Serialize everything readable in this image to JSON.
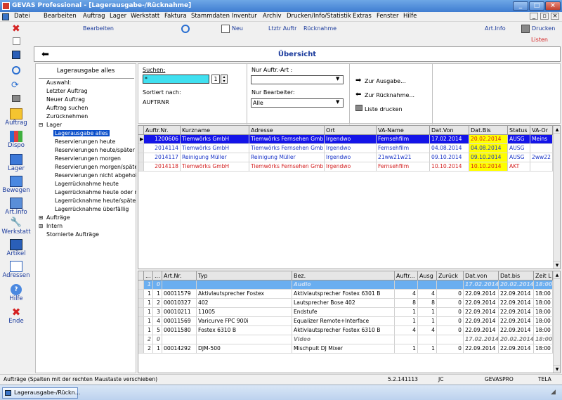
{
  "window": {
    "title": "GEVAS Professional - [Lagerausgabe-/Rücknahme]"
  },
  "menu": [
    "Datei",
    "Bearbeiten",
    "Auftrag",
    "Lager",
    "Werkstatt",
    "Faktura",
    "Stammdaten",
    "Inventur",
    "Archiv",
    "Drucken/Info/Statistik",
    "Extras",
    "Fenster",
    "Hilfe"
  ],
  "toolbar": {
    "edit": "Bearbeiten",
    "new": "Neu",
    "last_order": "Ltztr Auftr",
    "return": "Rücknahme",
    "art_info": "Art.Info",
    "print": "Drucken",
    "lists": "Listen"
  },
  "leftnav": [
    "Auftrag",
    "Dispo",
    "Lager",
    "Bewegen",
    "Art.Info",
    "Werkstatt",
    "Artikel",
    "Adressen",
    "Hilfe",
    "Ende"
  ],
  "header": {
    "title": "Übersicht"
  },
  "tree": {
    "heading": "Lagerausgabe alles",
    "items": [
      "Auswahl:",
      "Letzter Auftrag",
      "Neuer Auftrag",
      "Auftrag suchen",
      "Zurücknehmen",
      "Lager",
      "Lagerausgabe alles",
      "Reservierungen heute",
      "Reservierungen heute/später",
      "Reservierungen morgen",
      "Reservierungen morgen/später",
      "Reservierungen nicht abgeholt",
      "Lagerrücknahme heute",
      "Lagerrücknahme heute oder m",
      "Lagerrücknahme heute/später",
      "Lagerrücknahme überfällig",
      "Aufträge",
      "Intern",
      "Stornierte Aufträge"
    ]
  },
  "search": {
    "label": "Suchen:",
    "value": "*",
    "spin": "1",
    "sorted_label": "Sortiert nach:",
    "sorted_value": "AUFTRNR",
    "order_type_label": "Nur Auftr.-Art :",
    "order_type_value": "",
    "editor_label": "Nur Bearbeiter:",
    "editor_value": "Alle",
    "to_issue": "Zur Ausgabe...",
    "to_return": "Zur Rücknahme...",
    "print_list": "Liste drucken"
  },
  "grid1": {
    "columns": [
      "Auftr.Nr.",
      "Kurzname",
      "Adresse",
      "Ort",
      "VA-Name",
      "Dat.Von",
      "Dat.Bis",
      "Status",
      "VA-Or"
    ],
    "rows": [
      {
        "nr": "1200606",
        "kurz": "Tiemwörks GmbH",
        "adr": "Tiemwörks Fernsehen Gmb",
        "ort": "Irgendwo",
        "va": "Fernsehfilm",
        "von": "17.02.2014",
        "bis": "20.02.2014",
        "status": "AUSG",
        "vaor": "Meins",
        "style": "sel"
      },
      {
        "nr": "2014114",
        "kurz": "Tiemwörks GmbH",
        "adr": "Tiemwörks Fernsehen Gmb",
        "ort": "Irgendwo",
        "va": "Fernsehfilm",
        "von": "04.08.2014",
        "bis": "04.08.2014",
        "status": "AUSG",
        "vaor": "",
        "style": "blue"
      },
      {
        "nr": "2014117",
        "kurz": "Reinigung Müller",
        "adr": "Reinigung Müller",
        "ort": "Irgendwo",
        "va": "21ww21w21",
        "von": "09.10.2014",
        "bis": "09.10.2014",
        "status": "AUSG",
        "vaor": "2ww22",
        "style": "blue"
      },
      {
        "nr": "2014118",
        "kurz": "Tiemwörks GmbH",
        "adr": "Tiemwörks Fernsehen Gmb",
        "ort": "Irgendwo",
        "va": "Fernsehfilm",
        "von": "10.10.2014",
        "bis": "10.10.2014",
        "status": "AKT",
        "vaor": "",
        "style": "red"
      }
    ]
  },
  "grid2": {
    "columns": [
      "...",
      "...",
      "Art.Nr.",
      "Typ",
      "Bez.",
      "Auftr...",
      "Ausg",
      "Zurück",
      "Dat.von",
      "Dat.bis",
      "Zeit L"
    ],
    "rows": [
      {
        "a": "1",
        "b": "0",
        "art": "",
        "typ": "",
        "bez": "Audio",
        "auf": "",
        "aus": "",
        "zur": "",
        "von": "17.02.2014",
        "bis": "20.02.2014",
        "zeit": "18:00",
        "style": "grpsel"
      },
      {
        "a": "1",
        "b": "1",
        "art": "00011579",
        "typ": "Aktivlautsprecher Fostex",
        "bez": "Aktivlautsprecher Fostex 6301 B",
        "auf": "4",
        "aus": "4",
        "zur": "0",
        "von": "22.09.2014",
        "bis": "22.09.2014",
        "zeit": "18:00",
        "style": ""
      },
      {
        "a": "1",
        "b": "2",
        "art": "00010327",
        "typ": "402",
        "bez": "Lautsprecher Bose 402",
        "auf": "8",
        "aus": "8",
        "zur": "0",
        "von": "22.09.2014",
        "bis": "22.09.2014",
        "zeit": "18:00",
        "style": ""
      },
      {
        "a": "1",
        "b": "3",
        "art": "00010211",
        "typ": "11005",
        "bez": "Endstufe",
        "auf": "1",
        "aus": "1",
        "zur": "0",
        "von": "22.09.2014",
        "bis": "22.09.2014",
        "zeit": "18:00",
        "style": ""
      },
      {
        "a": "1",
        "b": "4",
        "art": "00011569",
        "typ": "Varicurve FPC 900i",
        "bez": "Equalizer Remote+Interface",
        "auf": "1",
        "aus": "1",
        "zur": "0",
        "von": "22.09.2014",
        "bis": "22.09.2014",
        "zeit": "18:00",
        "style": ""
      },
      {
        "a": "1",
        "b": "5",
        "art": "00011580",
        "typ": "Fostex 6310 B",
        "bez": "Aktivlautsprecher Fostex 6310 B",
        "auf": "4",
        "aus": "4",
        "zur": "0",
        "von": "22.09.2014",
        "bis": "22.09.2014",
        "zeit": "18:00",
        "style": ""
      },
      {
        "a": "2",
        "b": "0",
        "art": "",
        "typ": "",
        "bez": "Video",
        "auf": "",
        "aus": "",
        "zur": "",
        "von": "17.02.2014",
        "bis": "20.02.2014",
        "zeit": "18:00",
        "style": "grp"
      },
      {
        "a": "2",
        "b": "1",
        "art": "00014292",
        "typ": "DJM-500",
        "bez": "Mischpult DJ Mixer",
        "auf": "1",
        "aus": "1",
        "zur": "0",
        "von": "22.09.2014",
        "bis": "22.09.2014",
        "zeit": "18:00",
        "style": ""
      }
    ]
  },
  "status": {
    "hint": "Aufträge (Spalten mit der rechten Maustaste verschieben)",
    "version": "5.2.141113",
    "user": "JC",
    "db": "GEVASPRO",
    "mode": "TELA"
  },
  "taskbar": {
    "item": "Lagerausgabe-/Rückn..."
  }
}
